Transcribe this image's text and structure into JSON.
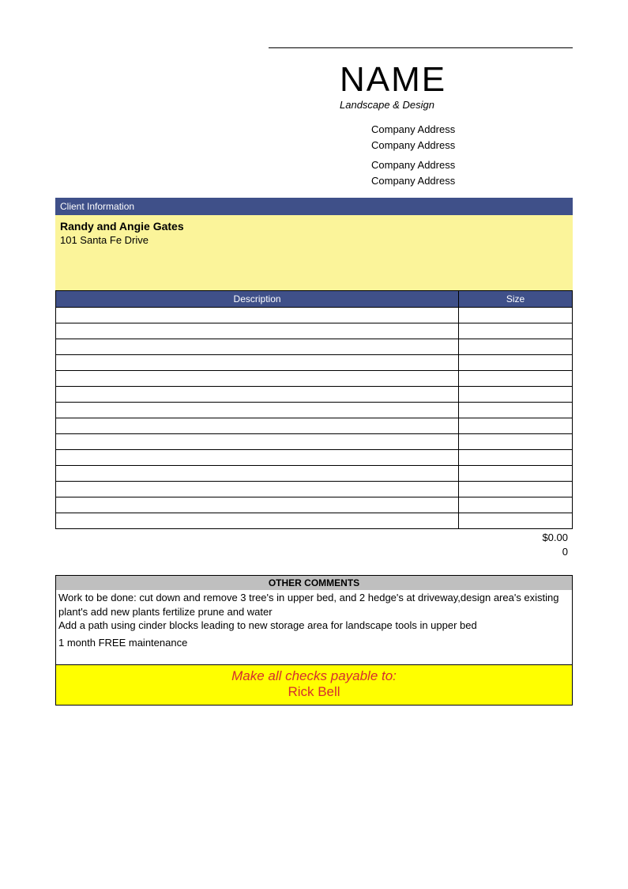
{
  "header": {
    "company_name": "NAME",
    "tagline": "Landscape & Design",
    "address_lines": [
      "Company Address",
      "Company Address",
      "Company Address",
      "Company Address"
    ]
  },
  "client_section": {
    "header": "Client Information",
    "name": "Randy and Angie Gates",
    "address": "101 Santa Fe Drive"
  },
  "line_items": {
    "columns": {
      "description": "Description",
      "size": "Size"
    },
    "rows": [
      {
        "description": "",
        "size": ""
      },
      {
        "description": "",
        "size": ""
      },
      {
        "description": "",
        "size": ""
      },
      {
        "description": "",
        "size": ""
      },
      {
        "description": "",
        "size": ""
      },
      {
        "description": "",
        "size": ""
      },
      {
        "description": "",
        "size": ""
      },
      {
        "description": "",
        "size": ""
      },
      {
        "description": "",
        "size": ""
      },
      {
        "description": "",
        "size": ""
      },
      {
        "description": "",
        "size": ""
      },
      {
        "description": "",
        "size": ""
      },
      {
        "description": "",
        "size": ""
      },
      {
        "description": "",
        "size": ""
      }
    ]
  },
  "totals": {
    "amount": "$0.00",
    "secondary": "0"
  },
  "comments": {
    "header": "OTHER COMMENTS",
    "lines": [
      "Work to be done: cut down and remove 3 tree's in upper bed, and 2 hedge's at driveway,design area's existing plant's add new plants fertilize prune and water",
      "Add a path using cinder blocks leading to new storage area for landscape tools in upper bed",
      "1 month FREE maintenance"
    ]
  },
  "payment": {
    "label": "Make all checks payable to:",
    "payee": "Rick Bell"
  }
}
